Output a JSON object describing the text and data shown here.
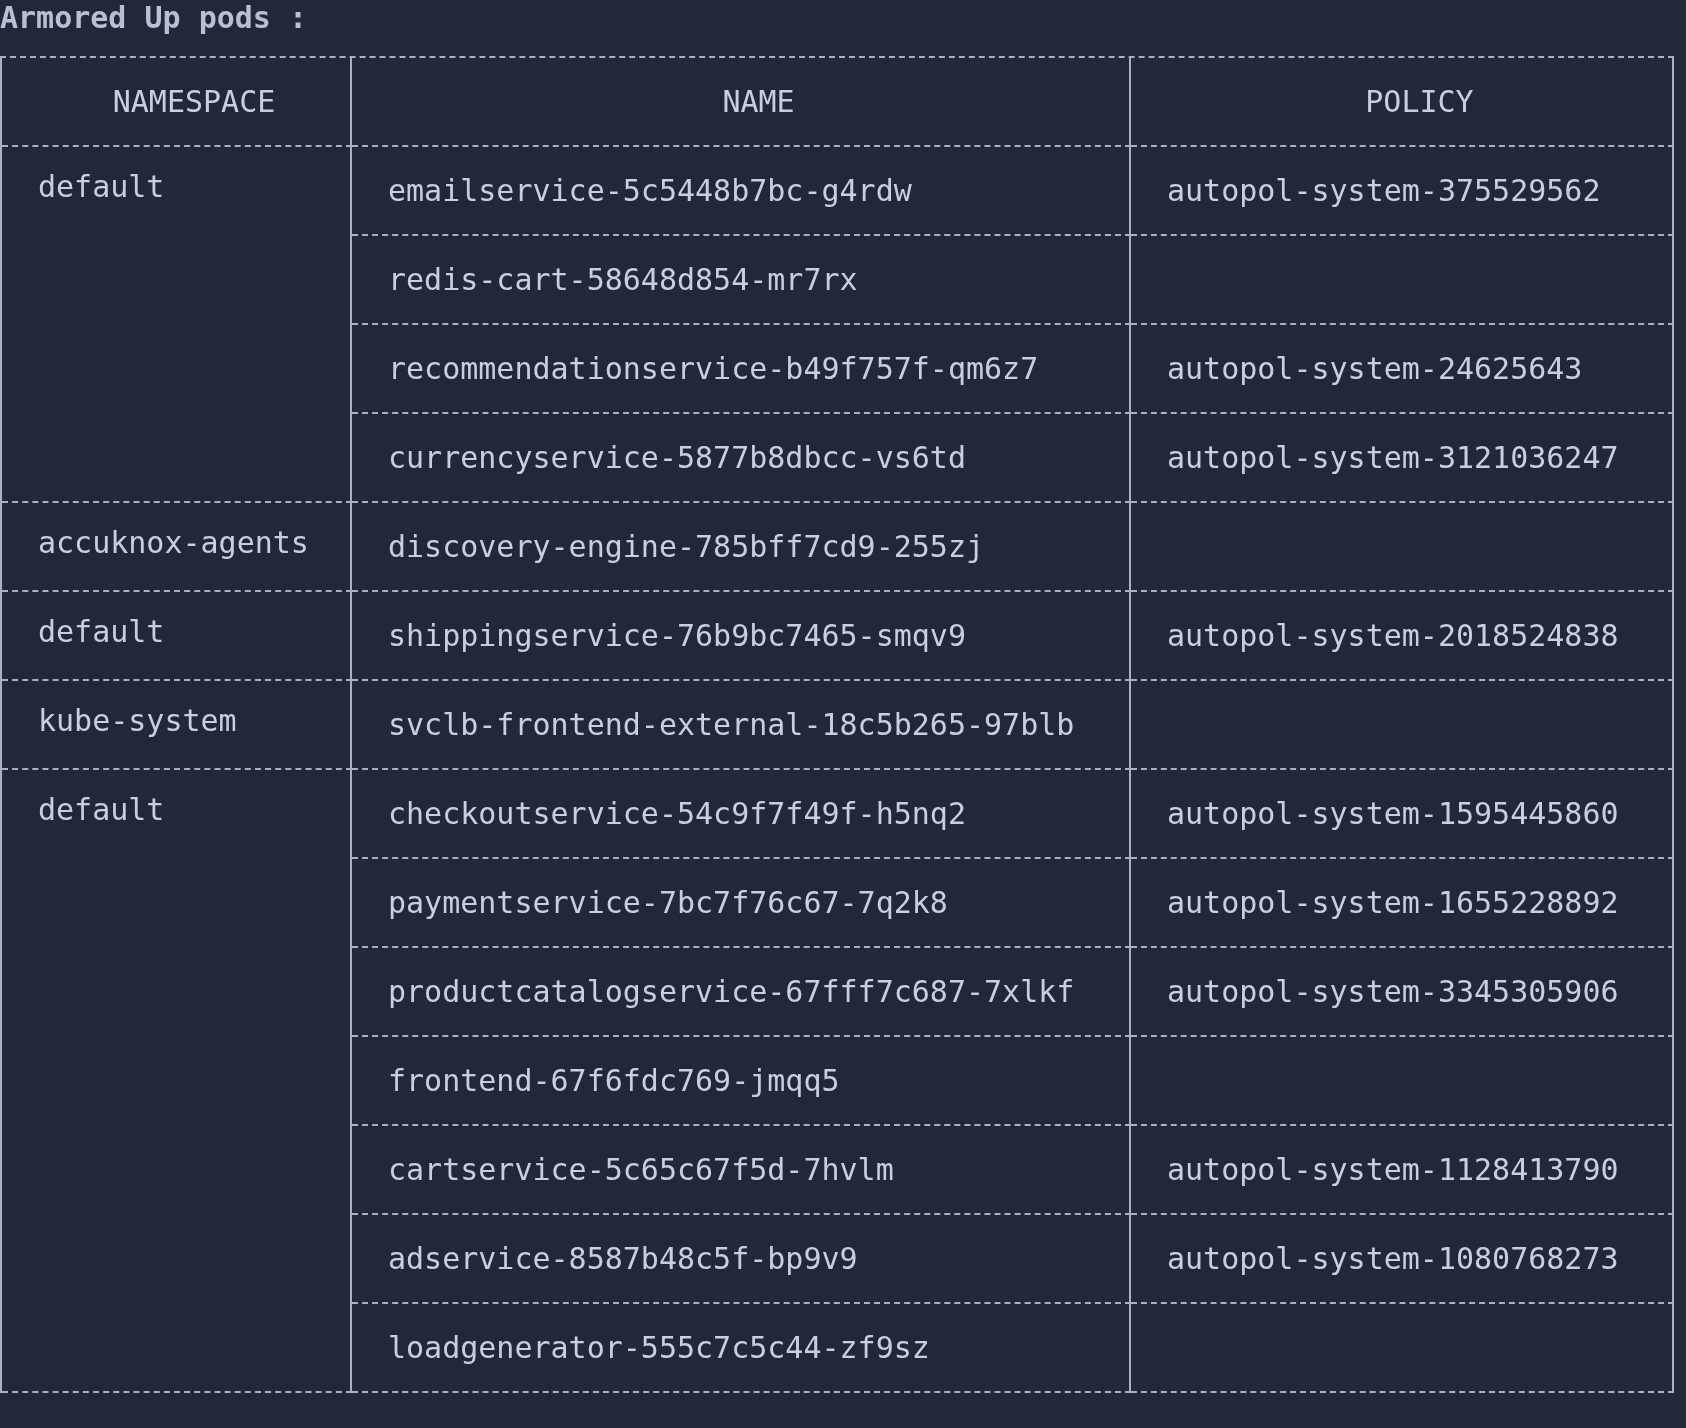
{
  "title": "Armored Up pods :",
  "columns": [
    "NAMESPACE",
    "NAME",
    "POLICY"
  ],
  "groups": [
    {
      "namespace": "default",
      "pods": [
        {
          "name": "emailservice-5c5448b7bc-g4rdw",
          "policy": "autopol-system-375529562"
        },
        {
          "name": "redis-cart-58648d854-mr7rx"
        },
        {
          "name": "recommendationservice-b49f757f-qm6z7",
          "policy": "autopol-system-24625643"
        },
        {
          "name": "currencyservice-5877b8dbcc-vs6td",
          "policy": "autopol-system-3121036247"
        }
      ]
    },
    {
      "namespace": "accuknox-agents",
      "pods": [
        {
          "name": "discovery-engine-785bff7cd9-255zj"
        }
      ]
    },
    {
      "namespace": "default",
      "pods": [
        {
          "name": "shippingservice-76b9bc7465-smqv9",
          "policy": "autopol-system-2018524838"
        }
      ]
    },
    {
      "namespace": "kube-system",
      "pods": [
        {
          "name": "svclb-frontend-external-18c5b265-97blb"
        }
      ]
    },
    {
      "namespace": "default",
      "pods": [
        {
          "name": "checkoutservice-54c9f7f49f-h5nq2",
          "policy": "autopol-system-1595445860"
        },
        {
          "name": "paymentservice-7bc7f76c67-7q2k8",
          "policy": "autopol-system-1655228892"
        },
        {
          "name": "productcatalogservice-67fff7c687-7xlkf",
          "policy": "autopol-system-3345305906"
        },
        {
          "name": "frontend-67f6fdc769-jmqq5"
        },
        {
          "name": "cartservice-5c65c67f5d-7hvlm",
          "policy": "autopol-system-1128413790"
        },
        {
          "name": "adservice-8587b48c5f-bp9v9",
          "policy": "autopol-system-1080768273"
        },
        {
          "name": "loadgenerator-555c7c5c44-zf9sz"
        }
      ]
    }
  ]
}
